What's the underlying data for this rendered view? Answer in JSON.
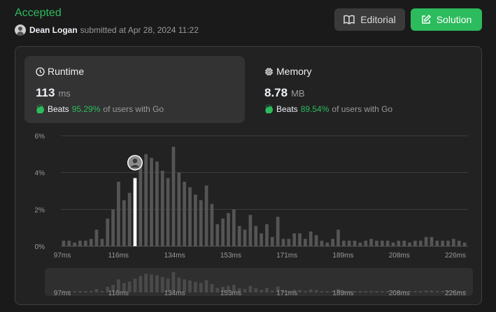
{
  "submission": {
    "status": "Accepted",
    "author": "Dean Logan",
    "submitted_text": "submitted at Apr 28, 2024 11:22"
  },
  "buttons": {
    "editorial_label": "Editorial",
    "solution_label": "Solution"
  },
  "runtime": {
    "title": "Runtime",
    "value": "113",
    "unit": "ms",
    "beats_label": "Beats",
    "beats_pct": "95.29%",
    "beats_suffix": "of users with Go"
  },
  "memory": {
    "title": "Memory",
    "value": "8.78",
    "unit": "MB",
    "beats_label": "Beats",
    "beats_pct": "89.54%",
    "beats_suffix": "of users with Go"
  },
  "colors": {
    "accent_green": "#2cbb5d",
    "bar": "#555555",
    "highlight_bar": "#ffffff"
  },
  "chart_data": {
    "type": "bar",
    "title": "",
    "xlabel": "",
    "ylabel": "",
    "x_tick_labels": [
      "97ms",
      "116ms",
      "134ms",
      "153ms",
      "171ms",
      "189ms",
      "208ms",
      "226ms"
    ],
    "y_tick_labels": [
      "6%",
      "4%",
      "2%",
      "0%"
    ],
    "ylim": [
      0,
      6
    ],
    "grid": true,
    "highlight_index": 13,
    "values": [
      0.3,
      0.3,
      0.2,
      0.3,
      0.3,
      0.4,
      0.9,
      0.4,
      1.5,
      2.0,
      3.5,
      2.5,
      2.9,
      3.7,
      4.4,
      5.0,
      4.8,
      4.6,
      4.1,
      3.7,
      5.4,
      4.0,
      3.5,
      3.2,
      2.8,
      2.5,
      3.3,
      2.3,
      1.2,
      1.5,
      1.8,
      2.0,
      1.1,
      0.9,
      1.7,
      1.1,
      0.7,
      1.2,
      0.5,
      1.6,
      0.4,
      0.4,
      0.7,
      0.7,
      0.4,
      0.8,
      0.6,
      0.3,
      0.2,
      0.4,
      0.9,
      0.3,
      0.3,
      0.3,
      0.2,
      0.3,
      0.4,
      0.3,
      0.3,
      0.3,
      0.2,
      0.3,
      0.3,
      0.2,
      0.3,
      0.3,
      0.5,
      0.5,
      0.3,
      0.3,
      0.3,
      0.4,
      0.3,
      0.2
    ]
  }
}
